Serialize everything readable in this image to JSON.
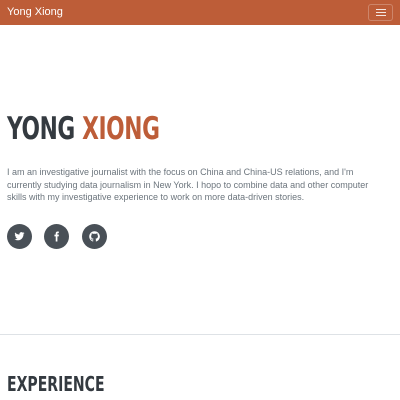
{
  "navbar": {
    "brand": "Yong Xiong",
    "toggler_icon": "hamburger-menu-icon",
    "background": "#bd5d38"
  },
  "hero": {
    "first_name": "Yong",
    "last_name": "Xiong",
    "bio": "I am an investigative journalist with the focus on China and China-US relations, and I'm currently studying data journalism in New York. I hopo to combine data and other computer skills with my investigative experience to work on more data-driven stories."
  },
  "social": [
    {
      "icon": "twitter-icon"
    },
    {
      "icon": "facebook-icon"
    },
    {
      "icon": "github-icon"
    }
  ],
  "sections": {
    "experience_title": "Experience"
  },
  "colors": {
    "accent": "#bd5d38",
    "heading": "#343a40",
    "text": "#6c757d",
    "social_bg": "#495057"
  }
}
